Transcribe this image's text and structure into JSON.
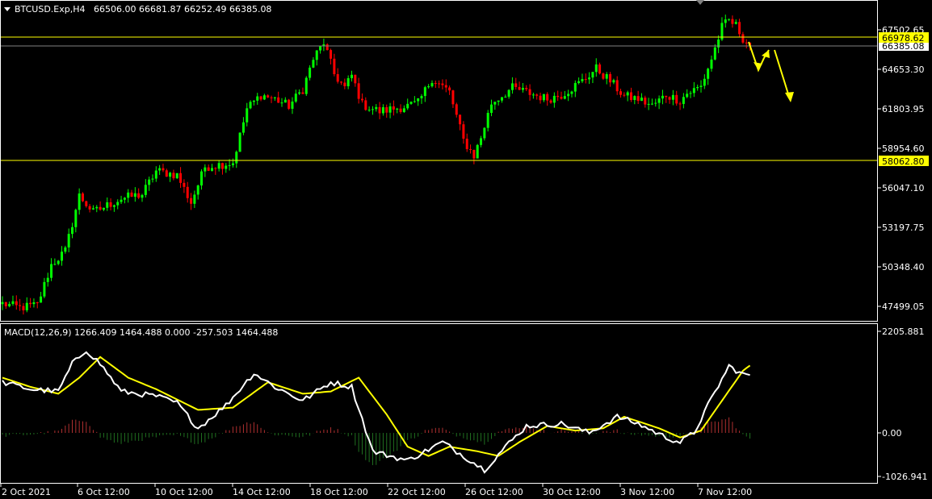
{
  "header": {
    "symbol_timeframe": "BTCUSD.Exp,H4",
    "ohlc": "66506.00 66681.87 66252.49 66385.08"
  },
  "price_axis": {
    "labels": [
      "67502.65",
      "64653.30",
      "61803.95",
      "58954.60",
      "56047.10",
      "53197.75",
      "50348.40",
      "47499.05"
    ],
    "current_price": "66385.08",
    "level_upper": "66978.62",
    "level_lower": "58062.80"
  },
  "macd": {
    "label": "MACD(12,26,9) 1266.409 1464.488 0.000 -257.503 1464.488",
    "axis_labels": [
      "2205.881",
      "0.00",
      "-1026.941"
    ]
  },
  "time_axis": {
    "labels": [
      "2 Oct 2021",
      "6 Oct 12:00",
      "10 Oct 12:00",
      "14 Oct 12:00",
      "18 Oct 12:00",
      "22 Oct 12:00",
      "26 Oct 12:00",
      "30 Oct 12:00",
      "3 Nov 12:00",
      "7 Nov 12:00"
    ]
  },
  "colors": {
    "background": "#000000",
    "bull_candle": "#00ff00",
    "bear_candle": "#ff0000",
    "level_line": "#ffff00",
    "arrow": "#ffff00",
    "macd_line": "#ffffff",
    "signal_line": "#ffff00",
    "hist_positive": "#b03030",
    "hist_negative": "#207020"
  },
  "chart_data": {
    "type": "candlestick",
    "levels": [
      66978.62,
      58062.8
    ],
    "price_keypoints": [
      [
        0,
        47700
      ],
      [
        5,
        47400
      ],
      [
        10,
        47600
      ],
      [
        14,
        50500
      ],
      [
        18,
        51500
      ],
      [
        22,
        55500
      ],
      [
        26,
        54300
      ],
      [
        34,
        55300
      ],
      [
        40,
        55600
      ],
      [
        44,
        57300
      ],
      [
        50,
        57000
      ],
      [
        54,
        55000
      ],
      [
        58,
        57600
      ],
      [
        66,
        57900
      ],
      [
        70,
        61800
      ],
      [
        74,
        62800
      ],
      [
        78,
        62500
      ],
      [
        82,
        62000
      ],
      [
        86,
        63200
      ],
      [
        89,
        65400
      ],
      [
        92,
        66600
      ],
      [
        95,
        64300
      ],
      [
        98,
        63300
      ],
      [
        100,
        64200
      ],
      [
        103,
        62100
      ],
      [
        108,
        61600
      ],
      [
        112,
        61800
      ],
      [
        116,
        62000
      ],
      [
        119,
        62200
      ],
      [
        123,
        64000
      ],
      [
        128,
        63000
      ],
      [
        132,
        59500
      ],
      [
        135,
        58400
      ],
      [
        137,
        59700
      ],
      [
        140,
        62200
      ],
      [
        146,
        63300
      ],
      [
        150,
        63000
      ],
      [
        156,
        62500
      ],
      [
        160,
        62800
      ],
      [
        166,
        63800
      ],
      [
        170,
        64700
      ],
      [
        174,
        63800
      ],
      [
        178,
        62700
      ],
      [
        182,
        62500
      ],
      [
        186,
        62000
      ],
      [
        190,
        62800
      ],
      [
        194,
        62400
      ],
      [
        196,
        62900
      ],
      [
        200,
        63400
      ],
      [
        203,
        65400
      ],
      [
        206,
        67700
      ],
      [
        208,
        68200
      ],
      [
        210,
        67800
      ],
      [
        212,
        66900
      ],
      [
        214,
        66385
      ]
    ],
    "macd_keypoints": [
      [
        0,
        1100
      ],
      [
        8,
        950
      ],
      [
        16,
        900
      ],
      [
        20,
        1500
      ],
      [
        24,
        1800
      ],
      [
        28,
        1500
      ],
      [
        34,
        900
      ],
      [
        44,
        800
      ],
      [
        50,
        650
      ],
      [
        56,
        100
      ],
      [
        64,
        600
      ],
      [
        72,
        1300
      ],
      [
        78,
        1000
      ],
      [
        86,
        700
      ],
      [
        94,
        1100
      ],
      [
        100,
        1000
      ],
      [
        106,
        -400
      ],
      [
        116,
        -600
      ],
      [
        126,
        -200
      ],
      [
        132,
        -500
      ],
      [
        138,
        -800
      ],
      [
        144,
        -300
      ],
      [
        150,
        150
      ],
      [
        160,
        200
      ],
      [
        168,
        0
      ],
      [
        176,
        350
      ],
      [
        182,
        200
      ],
      [
        190,
        -100
      ],
      [
        194,
        -200
      ],
      [
        198,
        0
      ],
      [
        202,
        600
      ],
      [
        208,
        1450
      ],
      [
        212,
        1266
      ]
    ],
    "signal_keypoints": [
      [
        0,
        1200
      ],
      [
        8,
        1000
      ],
      [
        16,
        850
      ],
      [
        22,
        1200
      ],
      [
        28,
        1650
      ],
      [
        36,
        1200
      ],
      [
        44,
        950
      ],
      [
        56,
        500
      ],
      [
        66,
        550
      ],
      [
        76,
        1100
      ],
      [
        86,
        850
      ],
      [
        94,
        900
      ],
      [
        102,
        1200
      ],
      [
        110,
        400
      ],
      [
        116,
        -300
      ],
      [
        122,
        -500
      ],
      [
        128,
        -300
      ],
      [
        136,
        -400
      ],
      [
        142,
        -500
      ],
      [
        148,
        -200
      ],
      [
        156,
        150
      ],
      [
        164,
        50
      ],
      [
        172,
        100
      ],
      [
        178,
        350
      ],
      [
        188,
        100
      ],
      [
        194,
        -100
      ],
      [
        200,
        50
      ],
      [
        206,
        700
      ],
      [
        212,
        1350
      ],
      [
        214,
        1464
      ]
    ]
  }
}
